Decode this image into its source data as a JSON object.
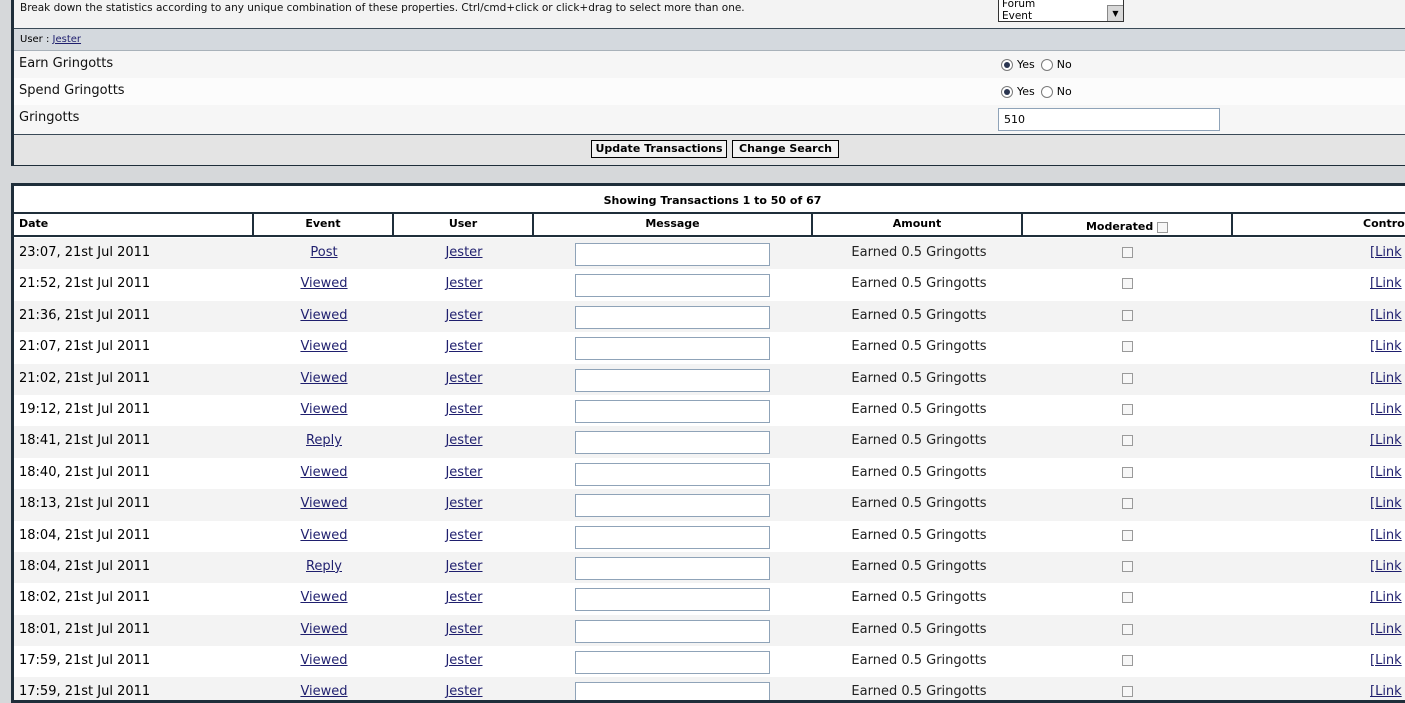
{
  "search": {
    "description": "Break down the statistics according to any unique combination of these properties. Ctrl/cmd+click or click+drag to select more than one.",
    "breakdown_options": [
      "Forum",
      "Event"
    ],
    "user_label": "User :",
    "user_value": "Jester",
    "earn": {
      "label": "Earn Gringotts",
      "yes": "Yes",
      "no": "No",
      "selected": "Yes"
    },
    "spend": {
      "label": "Spend Gringotts",
      "yes": "Yes",
      "no": "No",
      "selected": "Yes"
    },
    "gringotts": {
      "label": "Gringotts",
      "value": "510"
    },
    "update_button": "Update Transactions",
    "change_button": "Change Search"
  },
  "transactions": {
    "title": "Showing Transactions 1 to 50 of 67",
    "headers": {
      "date": "Date",
      "event": "Event",
      "user": "User",
      "message": "Message",
      "amount": "Amount",
      "moderated": "Moderated",
      "controls": "Controls"
    },
    "rows": [
      {
        "date": "23:07, 21st Jul 2011",
        "event": "Post",
        "user": "Jester",
        "amount": "Earned 0.5 Gringotts",
        "control": "[Link"
      },
      {
        "date": "21:52, 21st Jul 2011",
        "event": "Viewed",
        "user": "Jester",
        "amount": "Earned 0.5 Gringotts",
        "control": "[Link"
      },
      {
        "date": "21:36, 21st Jul 2011",
        "event": "Viewed",
        "user": "Jester",
        "amount": "Earned 0.5 Gringotts",
        "control": "[Link"
      },
      {
        "date": "21:07, 21st Jul 2011",
        "event": "Viewed",
        "user": "Jester",
        "amount": "Earned 0.5 Gringotts",
        "control": "[Link"
      },
      {
        "date": "21:02, 21st Jul 2011",
        "event": "Viewed",
        "user": "Jester",
        "amount": "Earned 0.5 Gringotts",
        "control": "[Link"
      },
      {
        "date": "19:12, 21st Jul 2011",
        "event": "Viewed",
        "user": "Jester",
        "amount": "Earned 0.5 Gringotts",
        "control": "[Link"
      },
      {
        "date": "18:41, 21st Jul 2011",
        "event": "Reply",
        "user": "Jester",
        "amount": "Earned 0.5 Gringotts",
        "control": "[Link"
      },
      {
        "date": "18:40, 21st Jul 2011",
        "event": "Viewed",
        "user": "Jester",
        "amount": "Earned 0.5 Gringotts",
        "control": "[Link"
      },
      {
        "date": "18:13, 21st Jul 2011",
        "event": "Viewed",
        "user": "Jester",
        "amount": "Earned 0.5 Gringotts",
        "control": "[Link"
      },
      {
        "date": "18:04, 21st Jul 2011",
        "event": "Viewed",
        "user": "Jester",
        "amount": "Earned 0.5 Gringotts",
        "control": "[Link"
      },
      {
        "date": "18:04, 21st Jul 2011",
        "event": "Reply",
        "user": "Jester",
        "amount": "Earned 0.5 Gringotts",
        "control": "[Link"
      },
      {
        "date": "18:02, 21st Jul 2011",
        "event": "Viewed",
        "user": "Jester",
        "amount": "Earned 0.5 Gringotts",
        "control": "[Link"
      },
      {
        "date": "18:01, 21st Jul 2011",
        "event": "Viewed",
        "user": "Jester",
        "amount": "Earned 0.5 Gringotts",
        "control": "[Link"
      },
      {
        "date": "17:59, 21st Jul 2011",
        "event": "Viewed",
        "user": "Jester",
        "amount": "Earned 0.5 Gringotts",
        "control": "[Link"
      },
      {
        "date": "17:59, 21st Jul 2011",
        "event": "Viewed",
        "user": "Jester",
        "amount": "Earned 0.5 Gringotts",
        "control": "[Link"
      }
    ]
  }
}
